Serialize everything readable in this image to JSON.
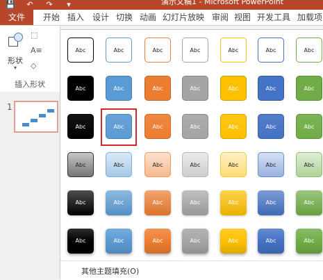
{
  "window": {
    "title": "演示文稿1 - Microsoft PowerPoint"
  },
  "quick_access": [
    {
      "name": "save-icon",
      "glyph": "💾"
    },
    {
      "name": "undo-icon",
      "glyph": "↶"
    },
    {
      "name": "redo-icon",
      "glyph": "↷"
    },
    {
      "name": "customize-icon",
      "glyph": "▾"
    }
  ],
  "ribbon": {
    "tabs": [
      "文件",
      "开始",
      "插入",
      "设计",
      "切换",
      "动画",
      "幻灯片放映",
      "审阅",
      "视图",
      "开发工具",
      "加载项"
    ],
    "shape_button_label": "形状",
    "shape_button_dropdown": "▾",
    "group_label": "插入形状",
    "tools": [
      "⬚",
      "A≡",
      "◇"
    ]
  },
  "slides": {
    "number": "1"
  },
  "gallery": {
    "cell_text": "Abc",
    "colors": [
      "black",
      "blue",
      "orange",
      "gray",
      "gold",
      "navy",
      "green"
    ],
    "hex": {
      "black": "#000000",
      "blue": "#5b9bd5",
      "orange": "#ed7d31",
      "gray": "#a5a5a5",
      "gold": "#ffc000",
      "navy": "#4472c4",
      "green": "#70ad47"
    },
    "rows": [
      "colored-outline",
      "colored-fill",
      "subtle-effect",
      "light-gradient",
      "intense-effect",
      "moderate-effect"
    ],
    "selected": {
      "row": 3,
      "col": 2
    },
    "more_fills": "其他主题填充(O)"
  }
}
